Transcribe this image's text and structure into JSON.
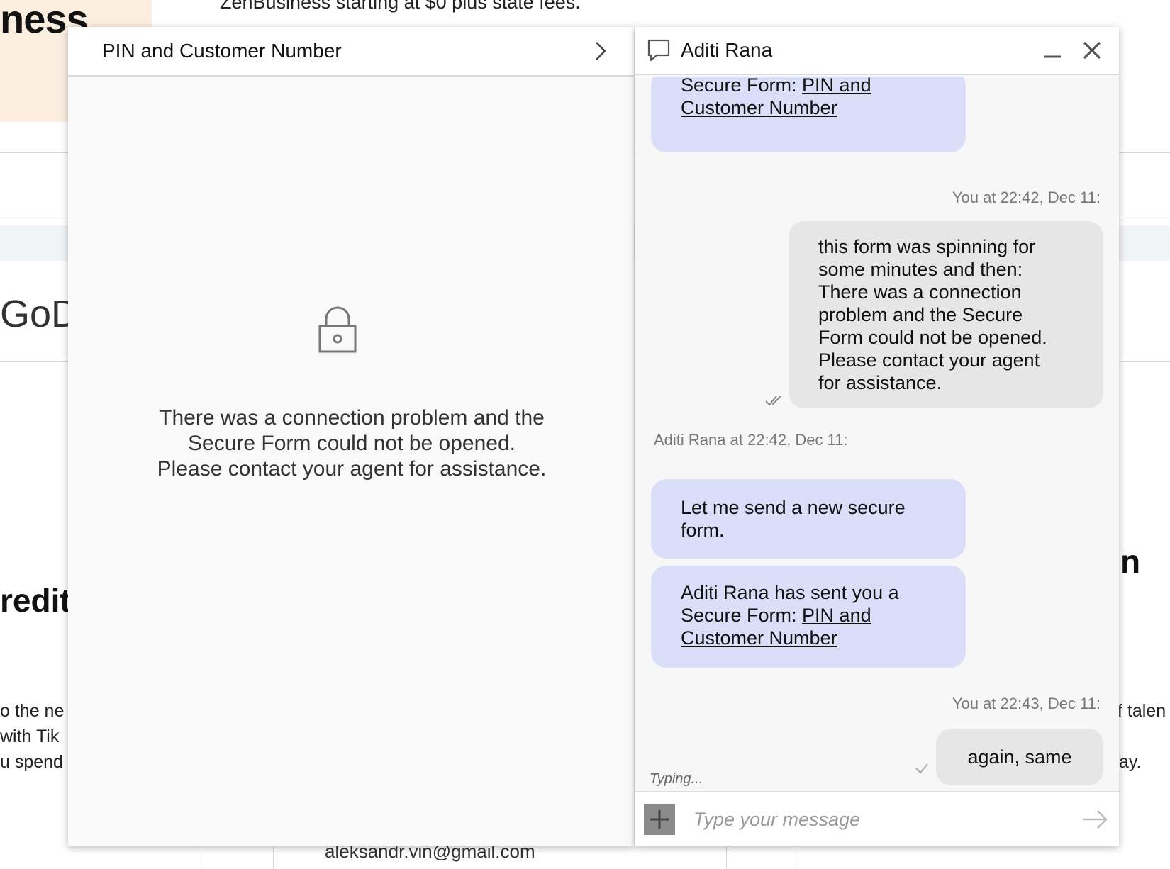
{
  "background": {
    "brand_partial": "ness",
    "promo_text": "ZenBusiness starting at $0 plus state fees.",
    "godaddy_partial": "GoDa",
    "credit_partial": "redit",
    "right_partial_heading": "n",
    "left_paragraph_lines": [
      "o the ne",
      "with Tik",
      "u spend"
    ],
    "right_paragraph_lines": [
      "f talen",
      "ay."
    ],
    "email": "aleksandr.vin@gmail.com"
  },
  "secure_form": {
    "title": "PIN and Customer Number",
    "error_lines": [
      "There was a connection problem and the",
      "Secure Form could not be opened.",
      "Please contact your agent for assistance."
    ]
  },
  "chat": {
    "agent_name": "Aditi Rana",
    "messages": [
      {
        "type": "agent",
        "prefix": "Secure Form: ",
        "link_line1": "PIN and",
        "link_line2": "Customer Number"
      },
      {
        "type": "user",
        "stamp": "You at 22:42, Dec 11:",
        "lines": [
          "this form was spinning for",
          "some minutes and then:",
          "There was a connection",
          "problem and the Secure",
          "Form could not be opened.",
          "Please contact your agent",
          "for assistance."
        ]
      },
      {
        "type": "agent",
        "stamp": "Aditi Rana at 22:42, Dec 11:",
        "lines": [
          "Let me send a new secure",
          "form."
        ]
      },
      {
        "type": "agent",
        "line1": "Aditi Rana has sent you a",
        "prefix": "Secure Form: ",
        "link_line1": "PIN and",
        "link_line2": "Customer Number"
      },
      {
        "type": "user",
        "stamp": "You at 22:43, Dec 11:",
        "text": "again, same"
      }
    ],
    "typing_indicator": "Typing...",
    "composer_placeholder": "Type your message"
  }
}
